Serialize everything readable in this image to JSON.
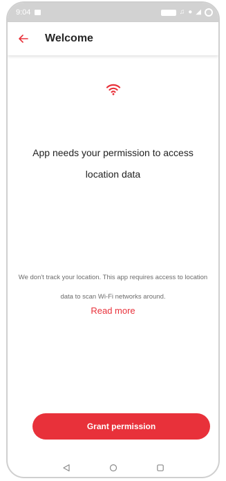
{
  "status_bar": {
    "time": "9:04"
  },
  "header": {
    "title": "Welcome",
    "back_icon": "arrow-left-icon"
  },
  "main": {
    "icon": "wifi-icon",
    "headline": "App needs your permission to access location data",
    "info": "We don't track your location. This app requires access to location data to scan Wi-Fi networks around.",
    "read_more_label": "Read more",
    "grant_button_label": "Grant permission"
  },
  "nav_bar": {
    "icons": [
      "back-triangle-icon",
      "home-circle-icon",
      "recents-square-icon"
    ]
  },
  "colors": {
    "accent": "#e8313a",
    "status_bar": "#d2d2d2",
    "text_primary": "#1f1f1f",
    "text_secondary": "#6b6b6b"
  }
}
